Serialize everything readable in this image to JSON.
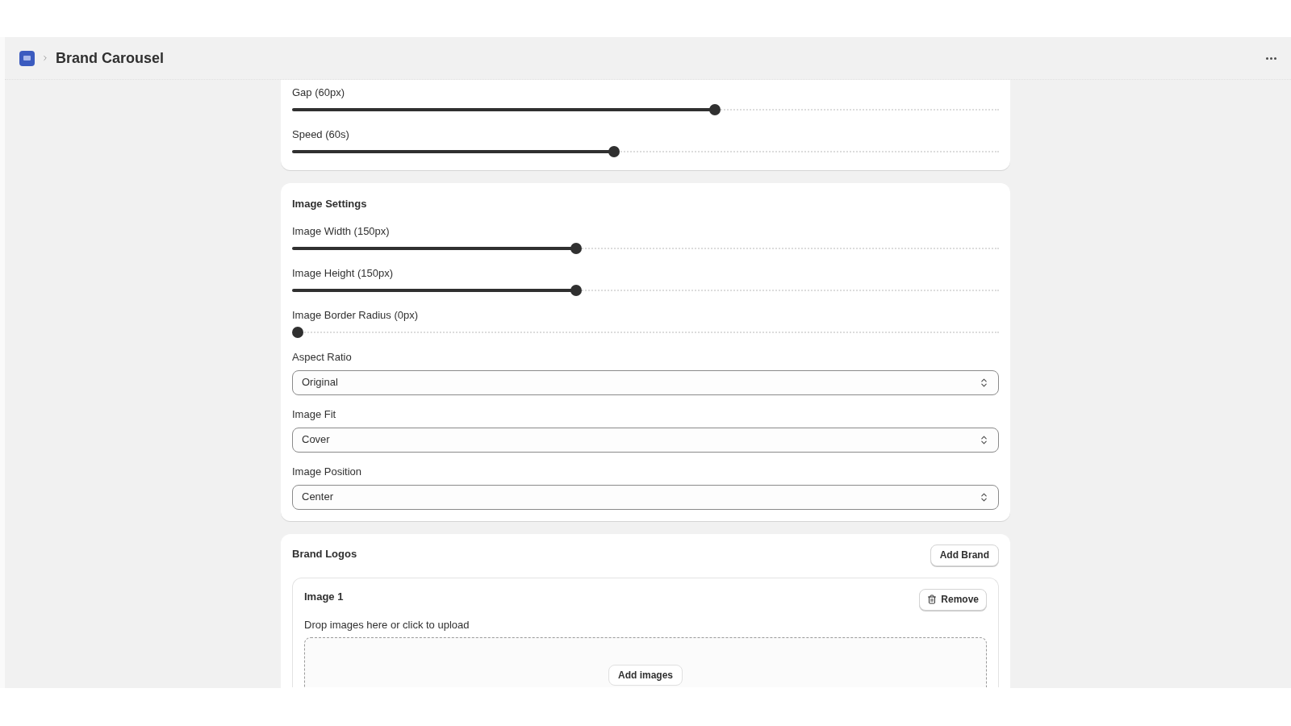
{
  "header": {
    "title": "Brand Carousel"
  },
  "carousel_sliders": [
    {
      "label": "Gap (60px)",
      "level": 0.6
    },
    {
      "label": "Speed (60s)",
      "level": 0.455
    }
  ],
  "image_settings": {
    "title": "Image Settings",
    "sliders": [
      {
        "label": "Image Width (150px)",
        "level": 0.4
      },
      {
        "label": "Image Height (150px)",
        "level": 0.4
      },
      {
        "label": "Image Border Radius (0px)",
        "level": 0
      }
    ],
    "selects": [
      {
        "label": "Aspect Ratio",
        "value": "Original"
      },
      {
        "label": "Image Fit",
        "value": "Cover"
      },
      {
        "label": "Image Position",
        "value": "Center"
      }
    ]
  },
  "brand_logos": {
    "title": "Brand Logos",
    "add_button": "Add Brand",
    "images": [
      {
        "title": "Image 1",
        "remove_button": "Remove",
        "drop_label": "Drop images here or click to upload",
        "add_images_button": "Add images"
      }
    ]
  }
}
